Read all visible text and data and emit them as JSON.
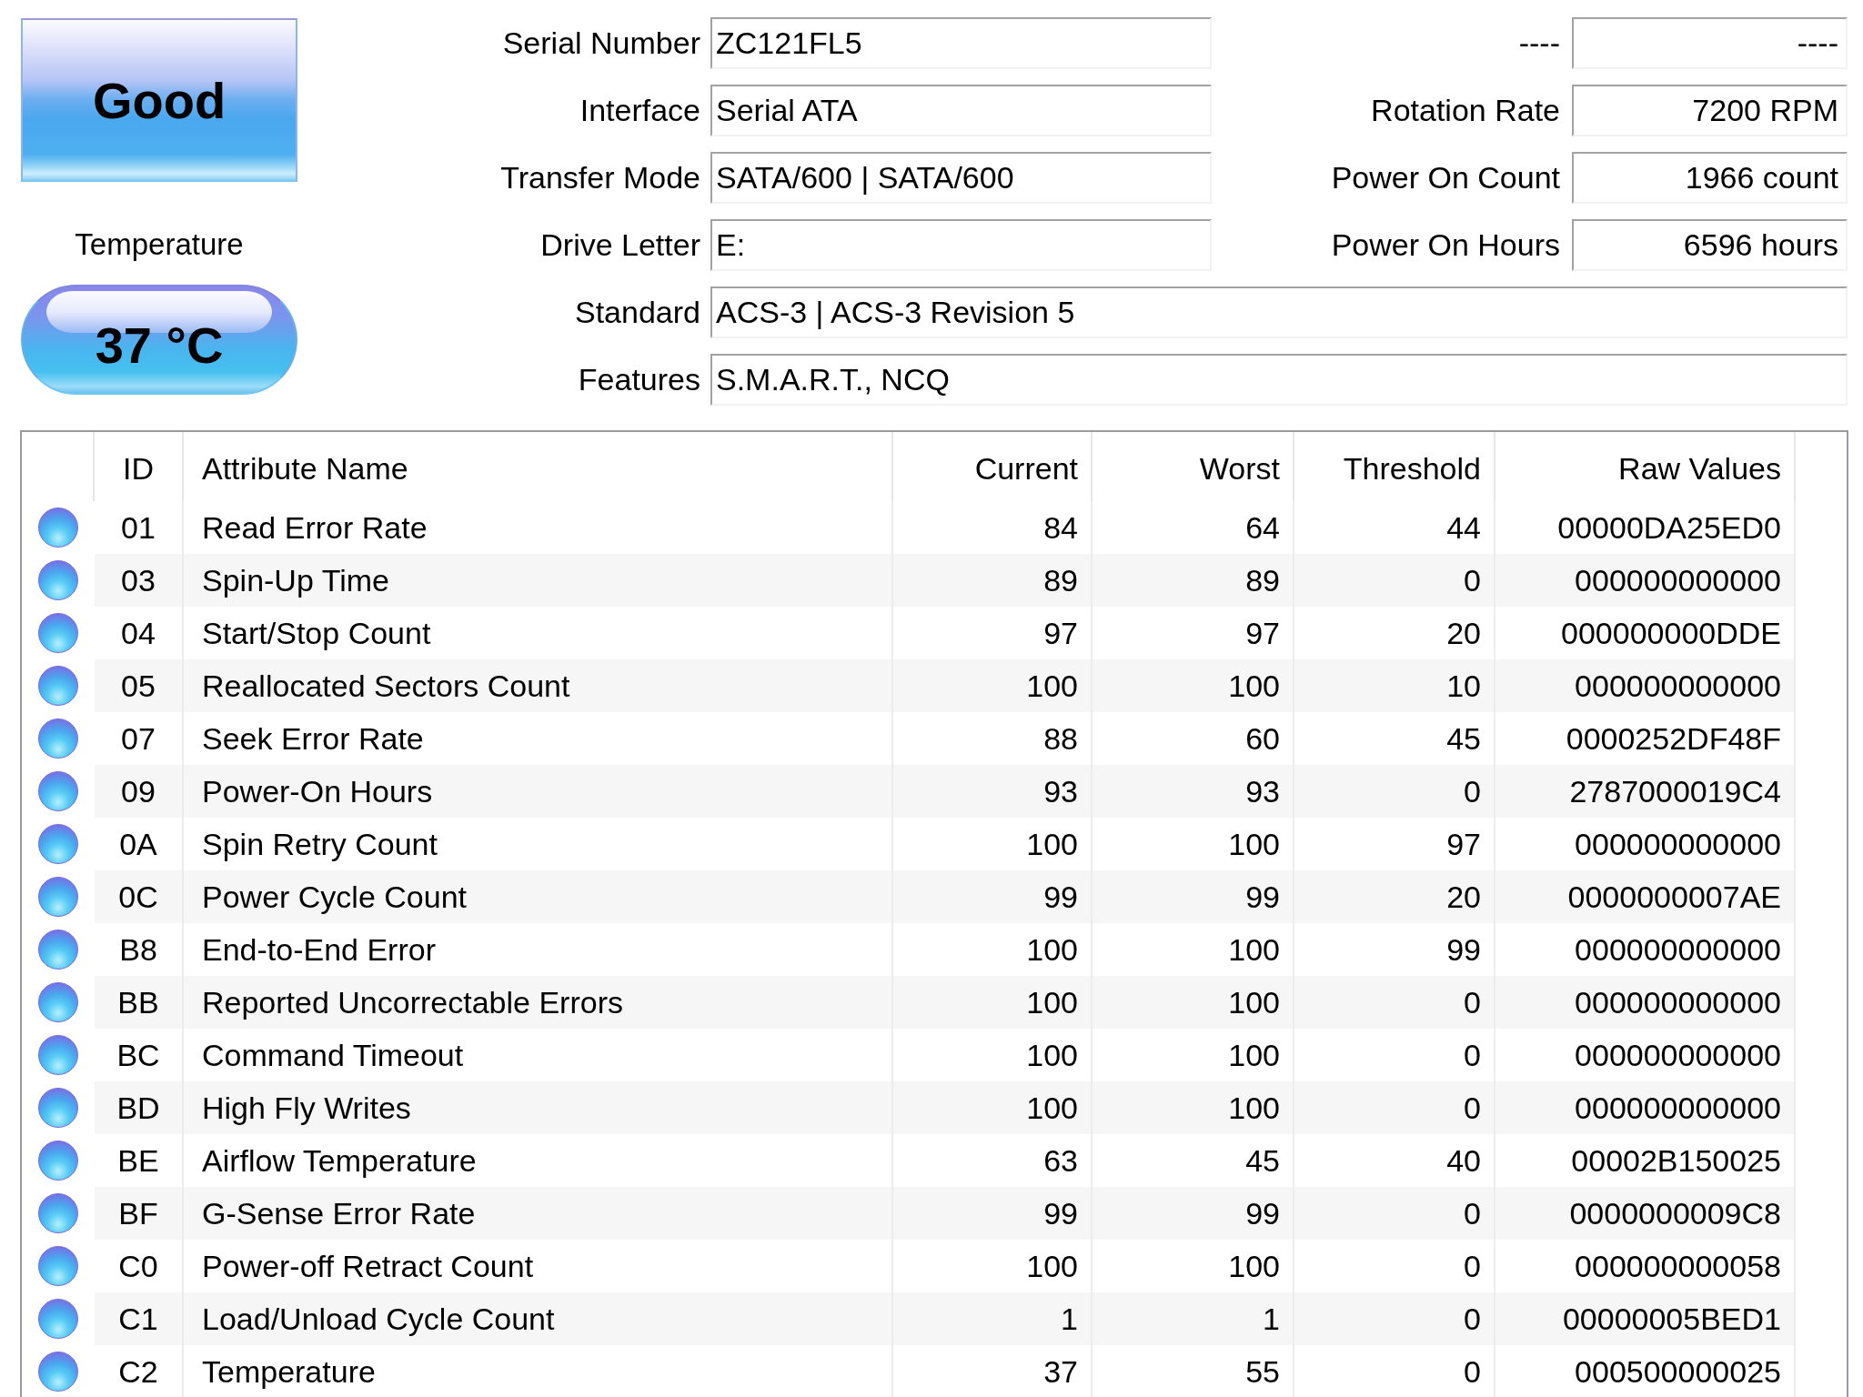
{
  "health": {
    "label": "Good"
  },
  "temperature": {
    "label": "Temperature",
    "value": "37 °C"
  },
  "info": {
    "left": [
      {
        "label": "Serial Number",
        "value": "ZC121FL5"
      },
      {
        "label": "Interface",
        "value": "Serial ATA"
      },
      {
        "label": "Transfer Mode",
        "value": "SATA/600 | SATA/600"
      },
      {
        "label": "Drive Letter",
        "value": "E:"
      }
    ],
    "right": [
      {
        "label": "----",
        "value": "----"
      },
      {
        "label": "Rotation Rate",
        "value": "7200 RPM"
      },
      {
        "label": "Power On Count",
        "value": "1966 count"
      },
      {
        "label": "Power On Hours",
        "value": "6596 hours"
      }
    ],
    "wide": [
      {
        "label": "Standard",
        "value": "ACS-3 | ACS-3 Revision 5"
      },
      {
        "label": "Features",
        "value": "S.M.A.R.T., NCQ"
      }
    ]
  },
  "smart_table": {
    "columns": [
      "ID",
      "Attribute Name",
      "Current",
      "Worst",
      "Threshold",
      "Raw Values"
    ],
    "rows": [
      {
        "caution": false,
        "cells": [
          "01",
          "Read Error Rate",
          "84",
          "64",
          "44",
          "00000DA25ED0"
        ]
      },
      {
        "caution": false,
        "cells": [
          "03",
          "Spin-Up Time",
          "89",
          "89",
          "0",
          "000000000000"
        ]
      },
      {
        "caution": false,
        "cells": [
          "04",
          "Start/Stop Count",
          "97",
          "97",
          "20",
          "000000000DDE"
        ]
      },
      {
        "caution": false,
        "cells": [
          "05",
          "Reallocated Sectors Count",
          "100",
          "100",
          "10",
          "000000000000"
        ]
      },
      {
        "caution": false,
        "cells": [
          "07",
          "Seek Error Rate",
          "88",
          "60",
          "45",
          "0000252DF48F"
        ]
      },
      {
        "caution": false,
        "cells": [
          "09",
          "Power-On Hours",
          "93",
          "93",
          "0",
          "2787000019C4"
        ]
      },
      {
        "caution": false,
        "cells": [
          "0A",
          "Spin Retry Count",
          "100",
          "100",
          "97",
          "000000000000"
        ]
      },
      {
        "caution": false,
        "cells": [
          "0C",
          "Power Cycle Count",
          "99",
          "99",
          "20",
          "0000000007AE"
        ]
      },
      {
        "caution": false,
        "cells": [
          "B8",
          "End-to-End Error",
          "100",
          "100",
          "99",
          "000000000000"
        ]
      },
      {
        "caution": false,
        "cells": [
          "BB",
          "Reported Uncorrectable Errors",
          "100",
          "100",
          "0",
          "000000000000"
        ]
      },
      {
        "caution": false,
        "cells": [
          "BC",
          "Command Timeout",
          "100",
          "100",
          "0",
          "000000000000"
        ]
      },
      {
        "caution": false,
        "cells": [
          "BD",
          "High Fly Writes",
          "100",
          "100",
          "0",
          "000000000000"
        ]
      },
      {
        "caution": false,
        "cells": [
          "BE",
          "Airflow Temperature",
          "63",
          "45",
          "40",
          "00002B150025"
        ]
      },
      {
        "caution": false,
        "cells": [
          "BF",
          "G-Sense Error Rate",
          "99",
          "99",
          "0",
          "0000000009C8"
        ]
      },
      {
        "caution": false,
        "cells": [
          "C0",
          "Power-off Retract Count",
          "100",
          "100",
          "0",
          "000000000058"
        ]
      },
      {
        "caution": false,
        "cells": [
          "C1",
          "Load/Unload Cycle Count",
          "1",
          "1",
          "0",
          "00000005BED1"
        ]
      },
      {
        "caution": false,
        "cells": [
          "C2",
          "Temperature",
          "37",
          "55",
          "0",
          "000500000025"
        ]
      }
    ]
  }
}
